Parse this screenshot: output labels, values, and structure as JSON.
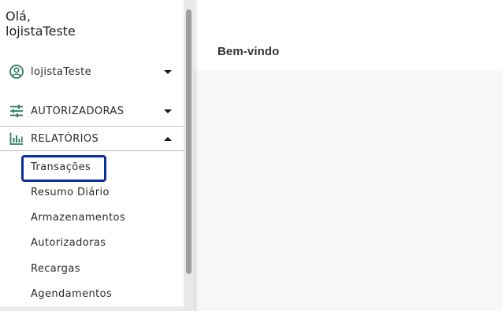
{
  "sidebar": {
    "greeting_line1": "Olá,",
    "greeting_line2": "lojistaTeste",
    "user_menu": {
      "label": "lojistaTeste",
      "icon": "user-circle-icon"
    },
    "autorizadoras_menu": {
      "label": "AUTORIZADORAS",
      "icon": "sliders-icon"
    },
    "relatorios_menu": {
      "label": "RELATÓRIOS",
      "icon": "bar-chart-icon",
      "expanded": true
    },
    "relatorios_items": [
      {
        "label": "Transações",
        "selected": true
      },
      {
        "label": "Resumo Diário"
      },
      {
        "label": "Armazenamentos"
      },
      {
        "label": "Autorizadoras"
      },
      {
        "label": "Recargas"
      },
      {
        "label": "Agendamentos"
      }
    ]
  },
  "main": {
    "title": "Bem-vindo"
  },
  "colors": {
    "accent_green": "#2e7d5b",
    "selection_border": "#0b2fa3"
  }
}
